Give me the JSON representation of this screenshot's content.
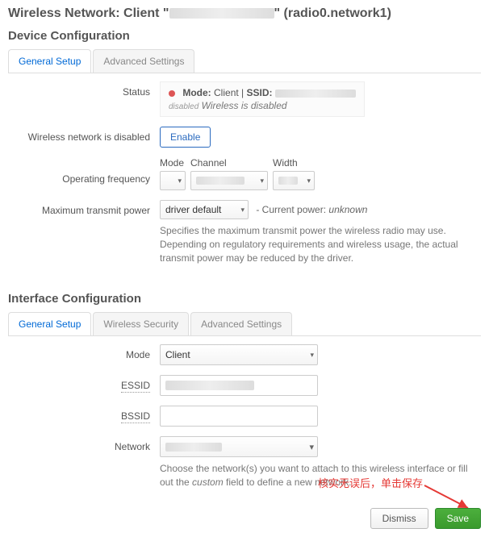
{
  "header": {
    "prefix": "Wireless Network: Client \"",
    "suffix": "\" (radio0.network1)"
  },
  "device": {
    "heading": "Device Configuration",
    "tabs": {
      "general": "General Setup",
      "advanced": "Advanced Settings"
    },
    "status": {
      "label": "Status",
      "mode_label": "Mode:",
      "mode_value": "Client",
      "sep": "|",
      "ssid_label": "SSID:",
      "disabled_small": "disabled",
      "disabled_msg": "Wireless is disabled"
    },
    "wireless_disabled": {
      "label": "Wireless network is disabled",
      "button": "Enable"
    },
    "freq": {
      "label": "Operating frequency",
      "mode": "Mode",
      "channel": "Channel",
      "width": "Width"
    },
    "txpower": {
      "label": "Maximum transmit power",
      "value": "driver default",
      "current_prefix": "- Current power:",
      "current_value": "unknown",
      "help": "Specifies the maximum transmit power the wireless radio may use. Depending on regulatory requirements and wireless usage, the actual transmit power may be reduced by the driver."
    }
  },
  "iface": {
    "heading": "Interface Configuration",
    "tabs": {
      "general": "General Setup",
      "security": "Wireless Security",
      "advanced": "Advanced Settings"
    },
    "mode": {
      "label": "Mode",
      "value": "Client"
    },
    "essid": {
      "label": "ESSID"
    },
    "bssid": {
      "label": "BSSID"
    },
    "network": {
      "label": "Network",
      "help_pre": "Choose the network(s) you want to attach to this wireless interface or fill out the ",
      "help_em": "custom",
      "help_post": " field to define a new network."
    }
  },
  "annotation": "核实无误后，单击保存",
  "footer": {
    "dismiss": "Dismiss",
    "save": "Save"
  }
}
